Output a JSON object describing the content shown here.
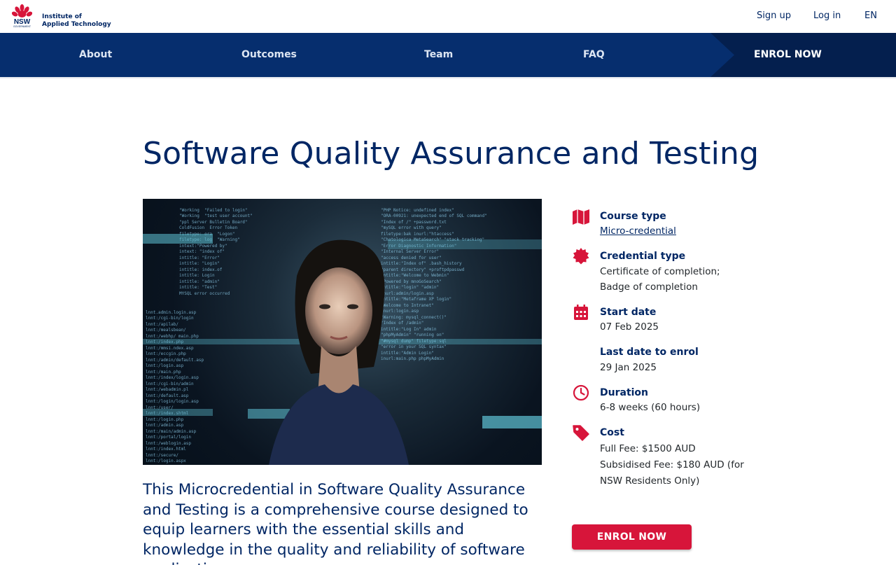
{
  "header": {
    "logo_text_line1": "Institute of",
    "logo_text_line2": "Applied Technology",
    "logo_mark": "NSW",
    "logo_sub": "GOVERNMENT",
    "links": {
      "sign_up": "Sign up",
      "log_in": "Log in",
      "language": "EN"
    }
  },
  "nav": {
    "about": "About",
    "outcomes": "Outcomes",
    "team": "Team",
    "faq": "FAQ",
    "enrol": "ENROL NOW"
  },
  "page": {
    "title": "Software Quality Assurance and Testing",
    "intro": "This Microcredential in Software Quality Assurance and Testing is a comprehensive course designed to equip learners with the essential skills and knowledge in the quality and reliability of software applications."
  },
  "sidebar": {
    "course_type": {
      "title": "Course type",
      "value": "Micro-credential",
      "icon": "map-icon"
    },
    "credential_type": {
      "title": "Credential type",
      "line1": "Certificate of completion;",
      "line2": "Badge of completion",
      "icon": "badge-icon"
    },
    "start_date": {
      "title": "Start date",
      "value": "07 Feb 2025",
      "icon": "calendar-icon"
    },
    "last_date": {
      "title": "Last date to enrol",
      "value": "29 Jan 2025"
    },
    "duration": {
      "title": "Duration",
      "value": "6-8 weeks (60 hours)",
      "icon": "clock-icon"
    },
    "cost": {
      "title": "Cost",
      "full_fee": "Full Fee: $1500 AUD",
      "subsidised_line1": "Subsidised Fee: $180 AUD (for",
      "subsidised_line2": "NSW Residents Only)",
      "icon": "tag-icon"
    },
    "enrol_button": "ENROL NOW"
  },
  "colors": {
    "navy": "#002664",
    "nav_bg": "#062e6e",
    "red": "#d7153a"
  }
}
